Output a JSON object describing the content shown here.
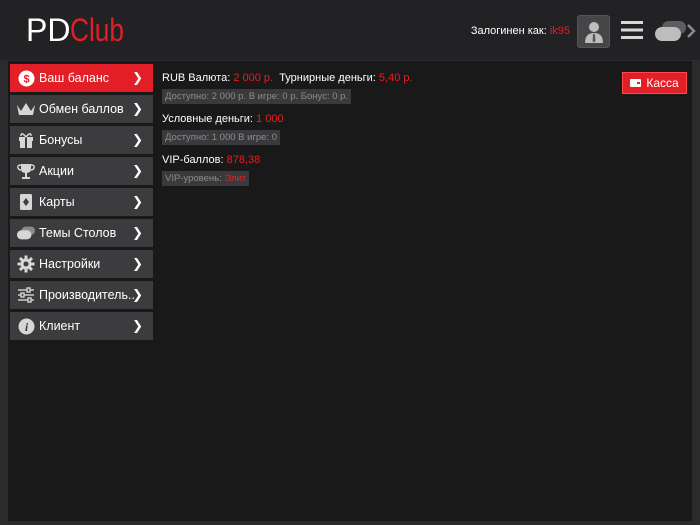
{
  "header": {
    "logo_pd": "PD",
    "logo_club": "Club",
    "login_label": "Залогинен как: ",
    "login_user": "ik95"
  },
  "sidebar": {
    "items": [
      {
        "label": "Ваш баланс",
        "icon": "dollar-coin-icon",
        "active": true
      },
      {
        "label": "Обмен баллов",
        "icon": "crown-icon"
      },
      {
        "label": "Бонусы",
        "icon": "gift-icon"
      },
      {
        "label": "Акции",
        "icon": "trophy-icon"
      },
      {
        "label": "Карты",
        "icon": "cards-icon"
      },
      {
        "label": "Темы Столов",
        "icon": "tables-icon"
      },
      {
        "label": "Настройки",
        "icon": "gear-icon"
      },
      {
        "label": "Производитель..",
        "icon": "sliders-icon"
      },
      {
        "label": "Клиент",
        "icon": "info-icon"
      }
    ],
    "chevron": "❯"
  },
  "balance": {
    "rub_label": "RUB Валюта: ",
    "rub_value": "2 000 р.",
    "tourney_label": "Турнирные деньги: ",
    "tourney_value": "5,40 р.",
    "rub_sub": "Доступно: 2 000 р.  В игре: 0 р.  Бонус: 0 р.",
    "cond_label": "Условные деньги: ",
    "cond_value": "1 000",
    "cond_sub": "Доступно: 1 000  В игре: 0",
    "vip_label": "VIP-баллов: ",
    "vip_value": "878,38",
    "vip_level_label": "VIP-уровень: ",
    "vip_level_value": "Элит"
  },
  "kassa_label": "Касса",
  "colors": {
    "accent": "#e21f26",
    "background": "#19191a",
    "sidebar_item": "#3c3c3e"
  }
}
